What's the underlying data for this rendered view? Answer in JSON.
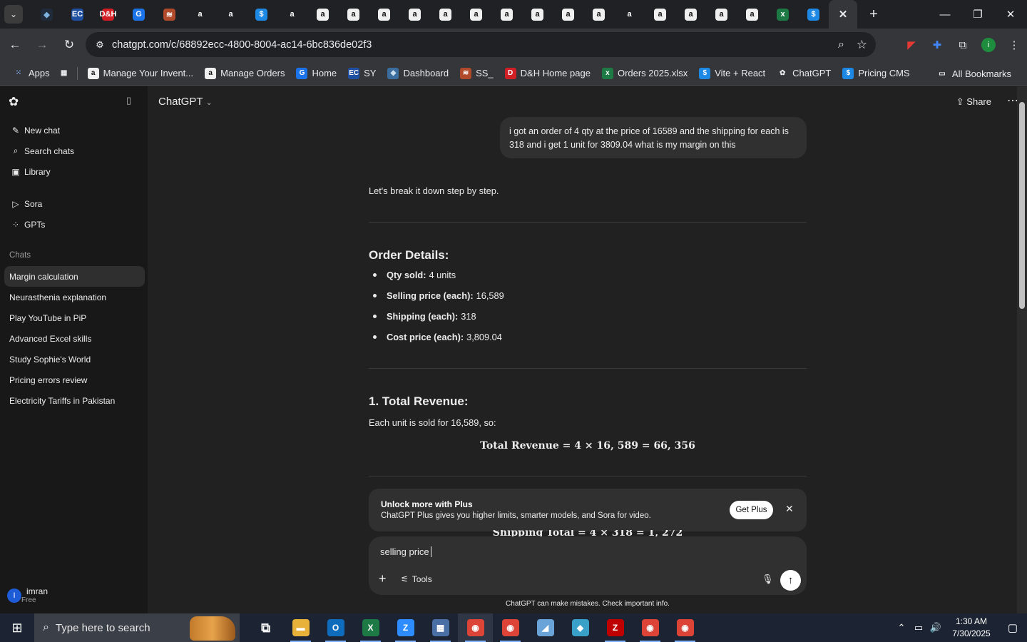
{
  "browser": {
    "tabs": [
      {
        "icon": "blue-diamond-icon",
        "bg": "#1f2b3a",
        "glyph": "◆",
        "color": "#7fb3e0"
      },
      {
        "icon": "ec-logo-icon",
        "bg": "#1f4fa0",
        "glyph": "EC",
        "color": "#fff"
      },
      {
        "icon": "red-square-icon",
        "bg": "#d11f26",
        "glyph": "D&H",
        "color": "#fff"
      },
      {
        "icon": "blue-box-icon",
        "bg": "#1a73e8",
        "glyph": "G",
        "color": "#fff"
      },
      {
        "icon": "orange-stack-icon",
        "bg": "#b04a2a",
        "glyph": "≋",
        "color": "#fff"
      },
      {
        "icon": "amazon-icon",
        "bg": "#202124",
        "glyph": "a",
        "color": "#fff"
      },
      {
        "icon": "amazon-icon",
        "bg": "#202124",
        "glyph": "a",
        "color": "#fff"
      },
      {
        "icon": "dollar-circle-icon",
        "bg": "#1e88e5",
        "glyph": "$",
        "color": "#fff"
      },
      {
        "icon": "amazon-icon",
        "bg": "#202124",
        "glyph": "a",
        "color": "#fff"
      },
      {
        "icon": "amazon-box-icon",
        "bg": "#f0f0f0",
        "glyph": "a",
        "color": "#111"
      },
      {
        "icon": "amazon-box-icon",
        "bg": "#f0f0f0",
        "glyph": "a",
        "color": "#111"
      },
      {
        "icon": "amazon-box-icon",
        "bg": "#f0f0f0",
        "glyph": "a",
        "color": "#111"
      },
      {
        "icon": "amazon-box-icon",
        "bg": "#f0f0f0",
        "glyph": "a",
        "color": "#111"
      },
      {
        "icon": "amazon-box-icon",
        "bg": "#f0f0f0",
        "glyph": "a",
        "color": "#111"
      },
      {
        "icon": "amazon-box-icon",
        "bg": "#f0f0f0",
        "glyph": "a",
        "color": "#111"
      },
      {
        "icon": "amazon-round-icon",
        "bg": "#f0f0f0",
        "glyph": "a",
        "color": "#111"
      },
      {
        "icon": "amazon-box-icon",
        "bg": "#f0f0f0",
        "glyph": "a",
        "color": "#111"
      },
      {
        "icon": "amazon-round-icon",
        "bg": "#f0f0f0",
        "glyph": "a",
        "color": "#111"
      },
      {
        "icon": "amazon-round-icon",
        "bg": "#f0f0f0",
        "glyph": "a",
        "color": "#111"
      },
      {
        "icon": "amazon-icon",
        "bg": "#202124",
        "glyph": "a",
        "color": "#fff"
      },
      {
        "icon": "amazon-round-icon",
        "bg": "#f0f0f0",
        "glyph": "a",
        "color": "#111"
      },
      {
        "icon": "amazon-round-icon",
        "bg": "#f0f0f0",
        "glyph": "a",
        "color": "#111"
      },
      {
        "icon": "amazon-round-icon",
        "bg": "#f0f0f0",
        "glyph": "a",
        "color": "#111"
      },
      {
        "icon": "amazon-round-icon",
        "bg": "#f0f0f0",
        "glyph": "a",
        "color": "#111"
      },
      {
        "icon": "excel-icon",
        "bg": "#1d7a45",
        "glyph": "x",
        "color": "#fff"
      },
      {
        "icon": "pricing-cms-icon",
        "bg": "#1e88e5",
        "glyph": "$",
        "color": "#fff"
      }
    ],
    "active_tab_close": "✕",
    "new_tab": "+",
    "url": "chatgpt.com/c/68892ecc-4800-8004-ac14-6bc836de02f3",
    "bookmarks": [
      {
        "label": "Apps",
        "icon": "apps-grid-icon",
        "bg": "transparent",
        "glyph": "⁙",
        "color": "#8ab4f8"
      },
      {
        "label": "",
        "icon": "tab-groups-icon",
        "bg": "transparent",
        "glyph": "▦",
        "color": "#e8eaed"
      },
      {
        "label": "Manage Your Invent...",
        "icon": "amazon-icon",
        "bg": "#f0f0f0",
        "glyph": "a",
        "color": "#111"
      },
      {
        "label": "Manage Orders",
        "icon": "amazon-icon",
        "bg": "#f0f0f0",
        "glyph": "a",
        "color": "#111"
      },
      {
        "label": "Home",
        "icon": "home-logo-icon",
        "bg": "#1a73e8",
        "glyph": "G",
        "color": "#fff"
      },
      {
        "label": "SY",
        "icon": "ec-logo-icon",
        "bg": "#1f4fa0",
        "glyph": "EC",
        "color": "#fff"
      },
      {
        "label": "Dashboard",
        "icon": "diamond-icon",
        "bg": "#3b6e9e",
        "glyph": "◆",
        "color": "#cde"
      },
      {
        "label": "SS_",
        "icon": "stack-icon",
        "bg": "#b04a2a",
        "glyph": "≋",
        "color": "#fff"
      },
      {
        "label": "D&H Home page",
        "icon": "dh-logo-icon",
        "bg": "#d11f26",
        "glyph": "D",
        "color": "#fff"
      },
      {
        "label": "Orders 2025.xlsx",
        "icon": "excel-icon",
        "bg": "#1d7a45",
        "glyph": "x",
        "color": "#fff"
      },
      {
        "label": "Vite + React",
        "icon": "dollar-circle-icon",
        "bg": "#1e88e5",
        "glyph": "$",
        "color": "#fff"
      },
      {
        "label": "ChatGPT",
        "icon": "openai-icon",
        "bg": "transparent",
        "glyph": "✿",
        "color": "#e8eaed"
      },
      {
        "label": "Pricing CMS",
        "icon": "dollar-circle-icon",
        "bg": "#1e88e5",
        "glyph": "$",
        "color": "#fff"
      }
    ],
    "all_bookmarks": "All Bookmarks"
  },
  "sidebar": {
    "nav": [
      {
        "label": "New chat",
        "icon": "new-chat-icon",
        "glyph": "✎"
      },
      {
        "label": "Search chats",
        "icon": "search-icon",
        "glyph": "⌕"
      },
      {
        "label": "Library",
        "icon": "library-icon",
        "glyph": "▣"
      }
    ],
    "tools": [
      {
        "label": "Sora",
        "icon": "sora-icon",
        "glyph": "▷"
      },
      {
        "label": "GPTs",
        "icon": "gpts-icon",
        "glyph": "⁘"
      }
    ],
    "chats_heading": "Chats",
    "chats": [
      "Margin calculation",
      "Neurasthenia explanation",
      "Play YouTube in PiP",
      "Advanced Excel skills",
      "Study Sophie's World",
      "Pricing errors review",
      "Electricity Tariffs in Pakistan"
    ],
    "user": {
      "initial": "I",
      "name": "imran",
      "plan": "Free"
    }
  },
  "main": {
    "model": "ChatGPT",
    "share": "Share",
    "user_message": "i got an order of 4 qty  at the price of  16589 and the shipping for each is 318 and i get 1 unit for 3809.04   what is my margin on this",
    "intro": "Let's break it down step by step.",
    "order_heading": "Order Details:",
    "order_items": [
      {
        "key": "Qty sold:",
        "value": "4 units"
      },
      {
        "key": "Selling price (each):",
        "value": "16,589"
      },
      {
        "key": "Shipping (each):",
        "value": "318"
      },
      {
        "key": "Cost price (each):",
        "value": "3,809.04"
      }
    ],
    "revenue_heading": "1. Total Revenue:",
    "revenue_text": "Each unit is sold for 16,589, so:",
    "revenue_formula": "Total Revenue = 4 × 16, 589 = 66, 356",
    "shipping_formula_peek": "Shipping Total = 4 × 318 = 1, 272",
    "promo": {
      "title": "Unlock more with Plus",
      "desc": "ChatGPT Plus gives you higher limits, smarter models, and Sora for video.",
      "button": "Get Plus"
    },
    "composer": {
      "value": "selling price",
      "tools": "Tools"
    },
    "disclaimer": "ChatGPT can make mistakes. Check important info."
  },
  "taskbar": {
    "search_placeholder": "Type here to search",
    "apps": [
      {
        "icon": "task-view-icon",
        "bg": "transparent",
        "glyph": "⧉",
        "open": false
      },
      {
        "icon": "file-explorer-icon",
        "bg": "#e8b23a",
        "glyph": "▬",
        "open": true
      },
      {
        "icon": "outlook-icon",
        "bg": "#0f6cbd",
        "glyph": "O",
        "open": true
      },
      {
        "icon": "excel-icon",
        "bg": "#1d7a45",
        "glyph": "X",
        "open": true
      },
      {
        "icon": "zoom-icon",
        "bg": "#2d8cff",
        "glyph": "Z",
        "open": true
      },
      {
        "icon": "calculator-icon",
        "bg": "#4a6fa5",
        "glyph": "▦",
        "open": true
      },
      {
        "icon": "chrome-icon",
        "bg": "#db4437",
        "glyph": "◉",
        "open": true,
        "focus": true
      },
      {
        "icon": "chrome-icon",
        "bg": "#db4437",
        "glyph": "◉",
        "open": true
      },
      {
        "icon": "notes-app-icon",
        "bg": "#6aa3d8",
        "glyph": "◢",
        "open": false
      },
      {
        "icon": "vscode-like-icon",
        "bg": "#39a0c8",
        "glyph": "◆",
        "open": false
      },
      {
        "icon": "filezilla-icon",
        "bg": "#bf0000",
        "glyph": "Z",
        "open": true
      },
      {
        "icon": "chrome-profile-icon",
        "bg": "#db4437",
        "glyph": "◉",
        "open": true
      },
      {
        "icon": "chrome-profile-icon",
        "bg": "#db4437",
        "glyph": "◉",
        "open": true
      }
    ],
    "time": "1:30 AM",
    "date": "7/30/2025"
  }
}
